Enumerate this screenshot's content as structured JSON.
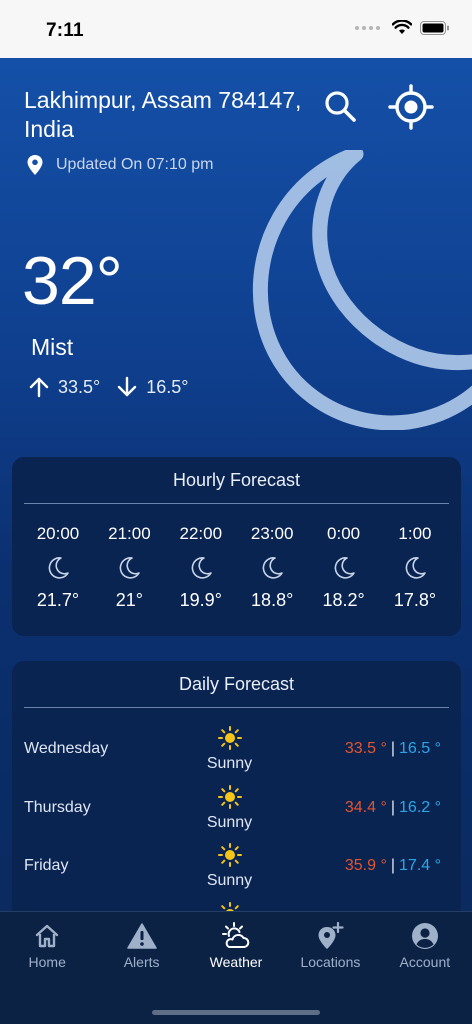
{
  "status_bar": {
    "time": "7:11"
  },
  "location": {
    "name": "Lakhimpur, Assam 784147, India",
    "updated": "Updated On 07:10 pm"
  },
  "current": {
    "temp": "32°",
    "condition": "Mist",
    "max": "33.5°",
    "min": "16.5°"
  },
  "hourly": {
    "title": "Hourly Forecast",
    "items": [
      {
        "time": "20:00",
        "icon": "moon-icon",
        "temp": "21.7°"
      },
      {
        "time": "21:00",
        "icon": "moon-icon",
        "temp": "21°"
      },
      {
        "time": "22:00",
        "icon": "moon-icon",
        "temp": "19.9°"
      },
      {
        "time": "23:00",
        "icon": "moon-icon",
        "temp": "18.8°"
      },
      {
        "time": "0:00",
        "icon": "moon-icon",
        "temp": "18.2°"
      },
      {
        "time": "1:00",
        "icon": "moon-icon",
        "temp": "17.8°"
      }
    ]
  },
  "daily": {
    "title": "Daily Forecast",
    "items": [
      {
        "day": "Wednesday",
        "icon": "sun-icon",
        "condition": "Sunny",
        "max": "33.5 °",
        "sep": "|",
        "min": "16.5 °"
      },
      {
        "day": "Thursday",
        "icon": "sun-icon",
        "condition": "Sunny",
        "max": "34.4 °",
        "sep": "|",
        "min": "16.2 °"
      },
      {
        "day": "Friday",
        "icon": "sun-icon",
        "condition": "Sunny",
        "max": "35.9 °",
        "sep": "|",
        "min": "17.4 °"
      },
      {
        "day": "",
        "icon": "sun-icon",
        "condition": "",
        "max": "",
        "sep": "",
        "min": ""
      }
    ]
  },
  "tabs": [
    {
      "label": "Home",
      "icon": "home-icon",
      "active": false
    },
    {
      "label": "Alerts",
      "icon": "alert-icon",
      "active": false
    },
    {
      "label": "Weather",
      "icon": "weather-icon",
      "active": true
    },
    {
      "label": "Locations",
      "icon": "location-add-icon",
      "active": false
    },
    {
      "label": "Account",
      "icon": "account-icon",
      "active": false
    }
  ],
  "colors": {
    "max_temp": "#e5542d",
    "min_temp": "#2aa7ea",
    "sun": "#f5c518"
  }
}
